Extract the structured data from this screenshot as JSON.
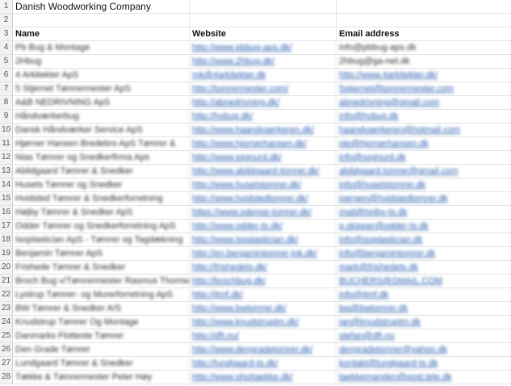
{
  "sheet": {
    "title": "Danish Woodworking Company",
    "headers": {
      "name": "Name",
      "website": "Website",
      "email": "Email address"
    },
    "rows": [
      {
        "name": "Pb Bug & Montage",
        "website": "http://www.pbbug-aps.dk/",
        "email": "info@pbbug-aps.dk"
      },
      {
        "name": "2Hbug",
        "website": "http://www.2hbug.dk/",
        "email": "2hbug@ga-net.dk"
      },
      {
        "name": "4 Arkitekter ApS",
        "website": "mk@4arkitekter.dk",
        "email": "http://www.4arkitekter.dk/"
      },
      {
        "name": "5 Stjernet Tømrermester ApS",
        "website": "http://tomrermester.com/",
        "email": "5stjernet@tomrermester.com"
      },
      {
        "name": "A&B NEDRIVNING ApS",
        "website": "http://abnedrivning.dk/",
        "email": "abnedrivning@gmail.com"
      },
      {
        "name": "Håndværkerbug",
        "website": "http://hvbug.dk/",
        "email": "info@hvbug.dk"
      },
      {
        "name": "Dansk Håndværker Service ApS",
        "website": "http://www.haandvaerkeren.dk/",
        "email": "haandvaerkeren@hotmail.com"
      },
      {
        "name": "Hjørner Hansen Bredebro ApS Tømrer &",
        "website": "http://www.hjornerhansen.dk/",
        "email": "ole@hjornerhansen.dk"
      },
      {
        "name": "Nias Tømrer og Snedkerfirma Aps",
        "website": "http://www.ssgnurd.dk/",
        "email": "info@ssgnurd.dk"
      },
      {
        "name": "Abildgaard Tømrer & Snedker",
        "website": "http://www.abildgaard-tomrer.dk/",
        "email": "abildgaard.tomrer@gmail.com"
      },
      {
        "name": "Husets Tømrer og Snedker",
        "website": "http://www.husetstomrer.dk/",
        "email": "info@husetstomrer.dk"
      },
      {
        "name": "Hvidsted Tømrer & Snedkerforretning",
        "website": "http://www.hvidstedtomrer.dk/",
        "email": "joergen@hvidstedtomrer.dk"
      },
      {
        "name": "Højby Tømrer & Snedker ApS",
        "website": "https://www.odense-tomrer.dk/",
        "email": "mail@hojby-ts.dk"
      },
      {
        "name": "Odder Tømrer og Snedkerforretning ApS",
        "website": "http://www.odder-ts.dk/",
        "email": "p.skipper@odder-ts.dk"
      },
      {
        "name": "Isoplastician ApS - Tømrer og Tagdækning",
        "website": "http://www.isoplastician.dk/",
        "email": "info@isoplastician.dk"
      },
      {
        "name": "Benjamin Tømrer ApS",
        "website": "http://en.benjamintomrer-jnk.dk/",
        "email": "info@benjamintomrer.dk"
      },
      {
        "name": "Frishede Tømrer & Snedker",
        "website": "http://frishedets.dk/",
        "email": "mark@frishedets.dk"
      },
      {
        "name": "Broch Bug v/Tømrermester Rasmus Thomsen",
        "website": "http://brochbug.dk/",
        "email": "BUCHERS@GMAIL.COM"
      },
      {
        "name": "Lystrup Tømrer- og Murerforretning ApS",
        "website": "http://jtmf.dk/",
        "email": "info@jtmf.dk"
      },
      {
        "name": "BW Tømrer & Snedker A/S",
        "website": "http://www.bwtomrer.dk/",
        "email": "bw@bwtomrer.dk"
      },
      {
        "name": "Knudstrup Tømrer Og Montage",
        "website": "http://www.knudstruptm.dk/",
        "email": "jan@knudstruptm.dk"
      },
      {
        "name": "Danmarks Flotteste Tømrer",
        "website": "http://dft.nu/",
        "email": "stefan@dft.nu"
      },
      {
        "name": "Den Grade Tømrer",
        "website": "http://www.dengradetomrer.dk/",
        "email": "dengradetomrer@yahoo.dk"
      },
      {
        "name": "Lundgaard Tømrer & Snedker",
        "website": "http://lundgaard-ts.dk/",
        "email": "kontakt@lundgaard-ts.dk"
      },
      {
        "name": "Tække & Tømrermester Peter Høy",
        "website": "http://www.phoitaekke.dk/",
        "email": "taekkemanden@post.tele.dk"
      }
    ]
  }
}
